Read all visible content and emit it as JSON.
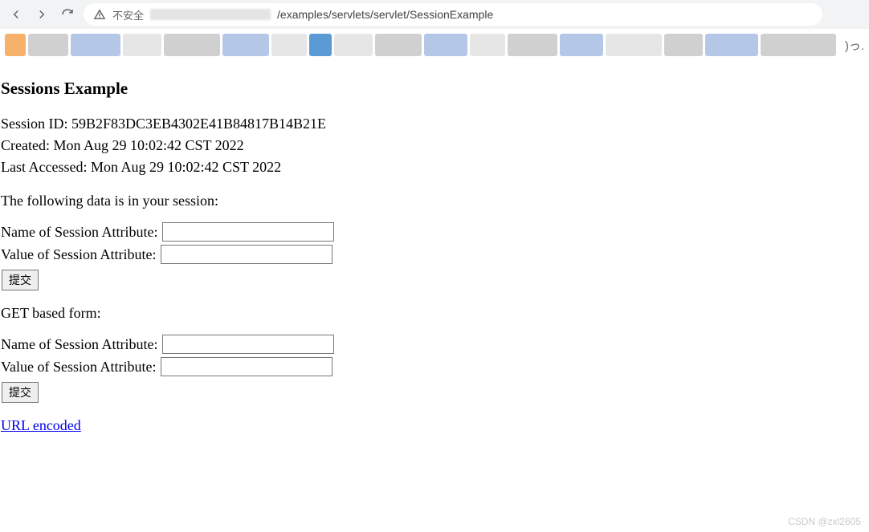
{
  "browser": {
    "security_text": "不安全",
    "url_path": "/examples/servlets/servlet/SessionExample",
    "toolbar_glyph": ")っ."
  },
  "page": {
    "heading": "Sessions Example",
    "session_id_label": "Session ID: ",
    "session_id_value": "59B2F83DC3EB4302E41B84817B14B21E",
    "created_label": "Created: ",
    "created_value": "Mon Aug 29 10:02:42 CST 2022",
    "last_accessed_label": "Last Accessed: ",
    "last_accessed_value": "Mon Aug 29 10:02:42 CST 2022",
    "session_data_heading": "The following data is in your session:",
    "form1": {
      "name_label": "Name of Session Attribute:",
      "value_label": "Value of Session Attribute:",
      "name_value": "",
      "value_value": "",
      "submit": "提交"
    },
    "get_form_heading": "GET based form:",
    "form2": {
      "name_label": "Name of Session Attribute:",
      "value_label": "Value of Session Attribute:",
      "name_value": "",
      "value_value": "",
      "submit": "提交"
    },
    "link_text": "URL encoded"
  },
  "watermark": "CSDN @zxl2605"
}
